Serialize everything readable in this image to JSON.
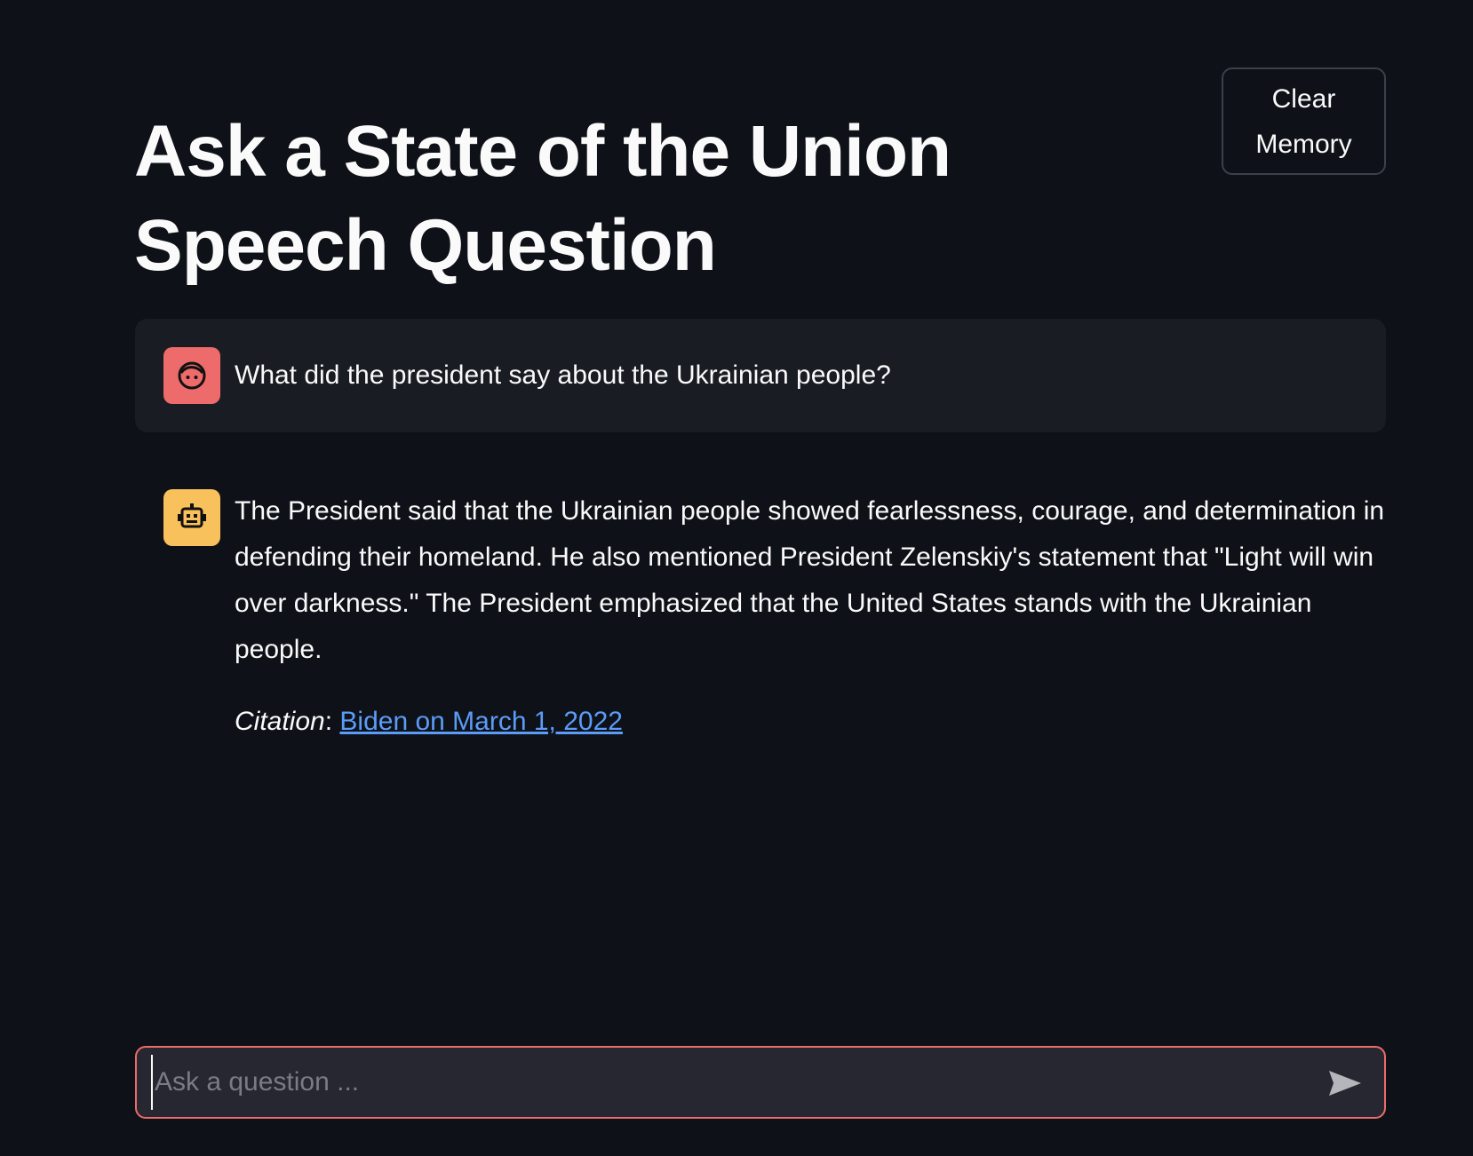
{
  "header": {
    "title": "Ask a State of the Union Speech Question",
    "clear_button_label": "Clear Memory"
  },
  "chat": {
    "messages": [
      {
        "role": "user",
        "avatar_icon": "face-icon",
        "avatar_color": "#ee6b6b",
        "text": "What did the president say about the Ukrainian people?"
      },
      {
        "role": "assistant",
        "avatar_icon": "robot-icon",
        "avatar_color": "#f9c15b",
        "text": "The President said that the Ukrainian people showed fearlessness, courage, and determination in defending their homeland. He also mentioned President Zelenskiy's statement that \"Light will win over darkness.\" The President emphasized that the United States stands with the Ukrainian people.",
        "citation_label": "Citation",
        "citation_separator": ":",
        "citation_link": "Biden on March 1, 2022"
      }
    ]
  },
  "input": {
    "placeholder": "Ask a question ...",
    "value": "",
    "send_icon": "send-icon",
    "border_color": "#ee6b6b"
  },
  "theme": {
    "background": "#0e1117",
    "link_color": "#5a9cf8"
  }
}
